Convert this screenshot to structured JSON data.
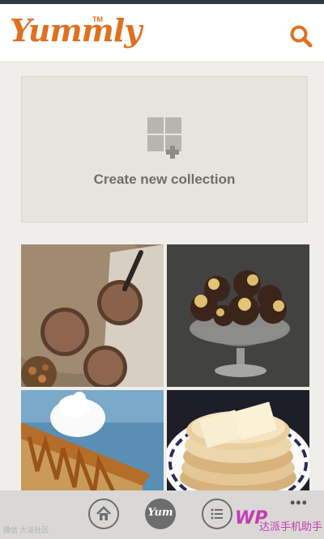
{
  "app": {
    "logo_text": "Yummly",
    "trademark": "TM"
  },
  "header": {
    "search_icon": "search-icon"
  },
  "collection": {
    "label": "Create new collection",
    "icon": "grid-plus-icon"
  },
  "recipes": [
    {
      "name": "hot-chocolate",
      "icon": "photo"
    },
    {
      "name": "buckeye-candies",
      "icon": "photo"
    },
    {
      "name": "caramel-cheesecake",
      "icon": "photo"
    },
    {
      "name": "pancakes-with-butter",
      "icon": "photo"
    }
  ],
  "bottom_nav": {
    "home_icon": "home-icon",
    "yum_label": "Yum",
    "list_icon": "list-icon",
    "more_label": "•••"
  },
  "watermark": {
    "left": "微信 大派社区",
    "brand_logo": "WP",
    "brand_text": "达派手机助手"
  },
  "colors": {
    "brand": "#e0701f",
    "nav_gray": "#6d6d6d",
    "background": "#efeeea"
  }
}
